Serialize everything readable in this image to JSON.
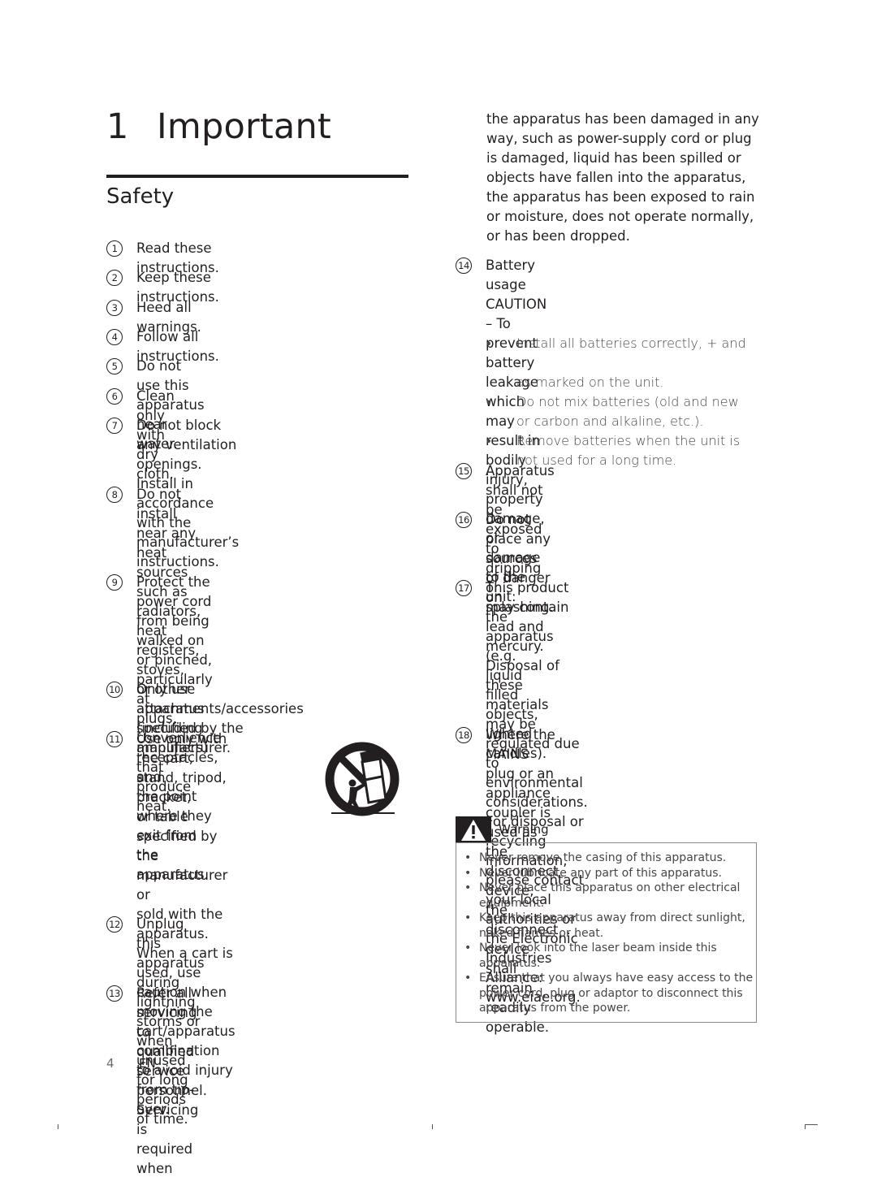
{
  "chapter": {
    "number": "1",
    "title": "Important"
  },
  "section": {
    "title": "Safety"
  },
  "items_left": [
    {
      "n": "1",
      "text": "Read these instructions."
    },
    {
      "n": "2",
      "text": "Keep these instructions."
    },
    {
      "n": "3",
      "text": "Heed all warnings."
    },
    {
      "n": "4",
      "text": "Follow all instructions."
    },
    {
      "n": "5",
      "text": "Do not use this apparatus near water."
    },
    {
      "n": "6",
      "text": "Clean only with dry cloth."
    },
    {
      "n": "7",
      "text": "Do not block any ventilation openings.\nInstall in accordance with the\nmanufacturer’s instructions."
    },
    {
      "n": "8",
      "text": "Do not install near any heat sources\nsuch as radiators, heat registers, stoves,\nor other apparatus (including amplifiers)\nthat produce heat."
    },
    {
      "n": "9",
      "text": "Protect the power cord from being\nwalked on or pinched, particularly at\nplugs, convenience receptacles, and\nthe point where they exit from the\napparatus."
    },
    {
      "n": "10",
      "text": "Only use attachments/accessories\nspecified by the manufacturer."
    },
    {
      "n": "11",
      "text": "Use only with the cart,\nstand, tripod, bracket,\nor table specified by\nthe manufacturer or\nsold with the apparatus.\nWhen a cart is used, use\ncaution when moving the cart/apparatus\ncombination to avoid injury from tip-\nover."
    },
    {
      "n": "12",
      "text": "Unplug this apparatus during lightning\nstorms or when unused for long periods\nof time."
    },
    {
      "n": "13",
      "text": "Refer all servicing to qualified service\npersonnel. Servicing is required when"
    }
  ],
  "item13_continued": "the apparatus has been damaged in any\nway, such as power-supply cord or plug\nis damaged, liquid has been spilled or\nobjects have fallen into the apparatus,\nthe apparatus has been exposed to rain\nor moisture, does not operate normally,\nor has been dropped.",
  "items_right": [
    {
      "n": "14",
      "text": "Battery usage CAUTION – To prevent\nbattery leakage which may result in\nbodily injury, property damage, or\ndamage to the unit:"
    },
    {
      "n": "15",
      "text": "Apparatus shall not be exposed to\ndripping or splashing."
    },
    {
      "n": "16",
      "text": "Do not place any sources of danger on\nthe apparatus (e.g. liquid filled objects,\nlighted candles)."
    },
    {
      "n": "17",
      "text": "This product may contain lead and\nmercury. Disposal of these materials\nmay be regulated due to environmental\nconsiderations. For disposal or recycling\ninformation, please contact your local\nauthorities or the Electronic Industries\nAlliance: www.eiae.org."
    },
    {
      "n": "18",
      "text": "Where the MAINS plug or an appliance\ncoupler is used as the disconnect device,\nthe disconnect device shall remain\nreadily operable."
    }
  ],
  "battery_bullets": [
    {
      "bullet": "•",
      "text": "Install all batteries correctly, + and -\nas marked on the unit."
    },
    {
      "bullet": "•",
      "text": "Do not mix batteries (old and new\nor carbon and alkaline, etc.)."
    },
    {
      "bullet": "•",
      "text": "Remove batteries when the unit is\nnot used for a long time."
    }
  ],
  "warning": {
    "icon": "warning-triangle-icon",
    "label": "Warning",
    "items": [
      {
        "bullet": "•",
        "text": "Never remove the casing of this apparatus."
      },
      {
        "bullet": "•",
        "text": "Never lubricate any part of this apparatus."
      },
      {
        "bullet": "•",
        "text": "Never place this apparatus on other electrical\nequipment."
      },
      {
        "bullet": "•",
        "text": "Keep this apparatus away from direct sunlight,\nnaked flames or heat."
      },
      {
        "bullet": "•",
        "text": "Never look into the laser beam inside this\napparatus."
      },
      {
        "bullet": "•",
        "text": "Ensure that you always have easy access to the\npower cord, plug or adaptor to disconnect this\napparatus from the power."
      }
    ]
  },
  "cart_warning_icon": "cart-tip-over-icon",
  "footer": {
    "page_number": "4",
    "language": "EN"
  },
  "colors": {
    "text": "#231f20",
    "muted_text": "#4a4546",
    "box_border": "#8a8a8a"
  }
}
